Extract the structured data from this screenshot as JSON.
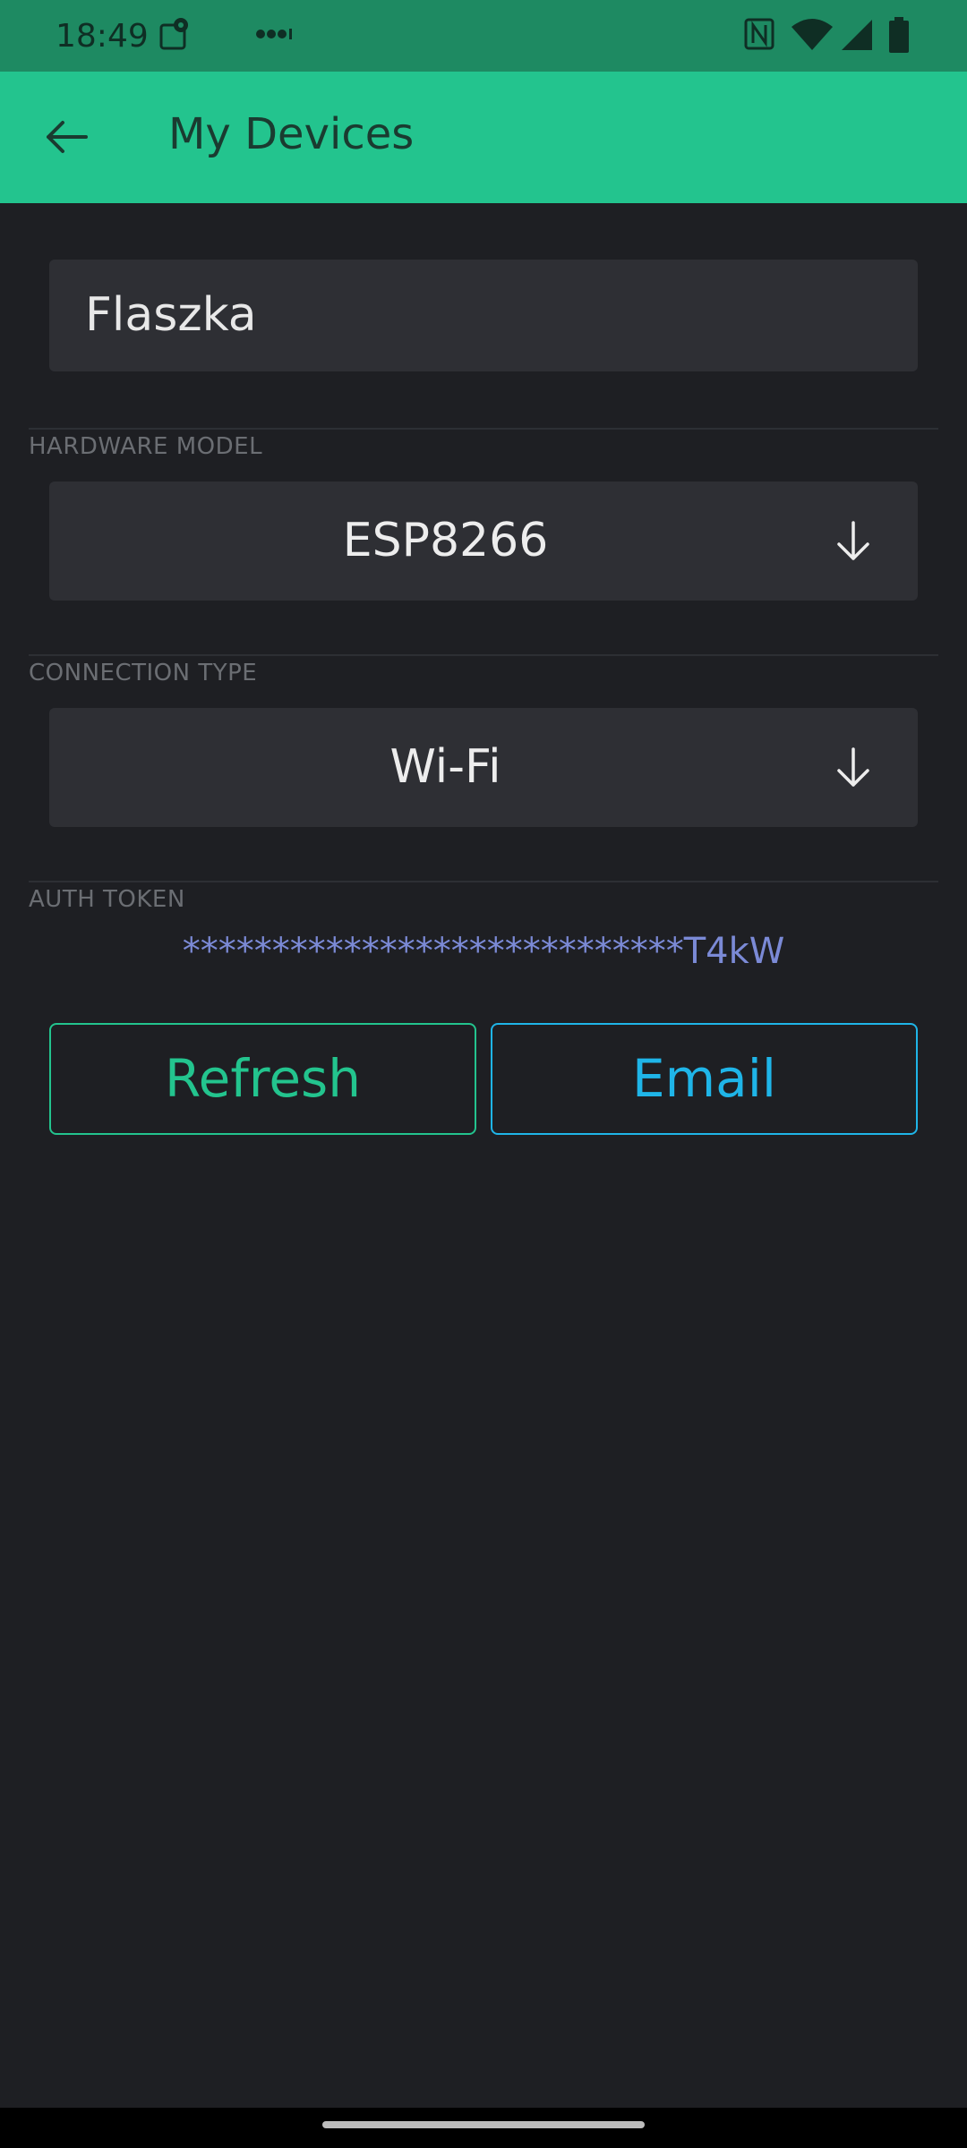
{
  "status_bar": {
    "time": "18:49",
    "icons": [
      "maps-notification-icon",
      "more-dots-icon",
      "nfc-icon",
      "wifi-icon",
      "signal-icon",
      "battery-icon"
    ]
  },
  "app_bar": {
    "title": "My Devices",
    "back_icon": "arrow-left-icon"
  },
  "device": {
    "name": "Flaszka"
  },
  "hardware": {
    "label": "HARDWARE MODEL",
    "value": "ESP8266"
  },
  "connection": {
    "label": "CONNECTION TYPE",
    "value": "Wi-Fi"
  },
  "auth": {
    "label": "AUTH TOKEN",
    "token": "****************************T4kW"
  },
  "actions": {
    "refresh_label": "Refresh",
    "email_label": "Email"
  },
  "colors": {
    "accent_green": "#23c48e",
    "accent_blue": "#1fb5e8",
    "token_color": "#7b8ad6",
    "background": "#1e1f23"
  }
}
